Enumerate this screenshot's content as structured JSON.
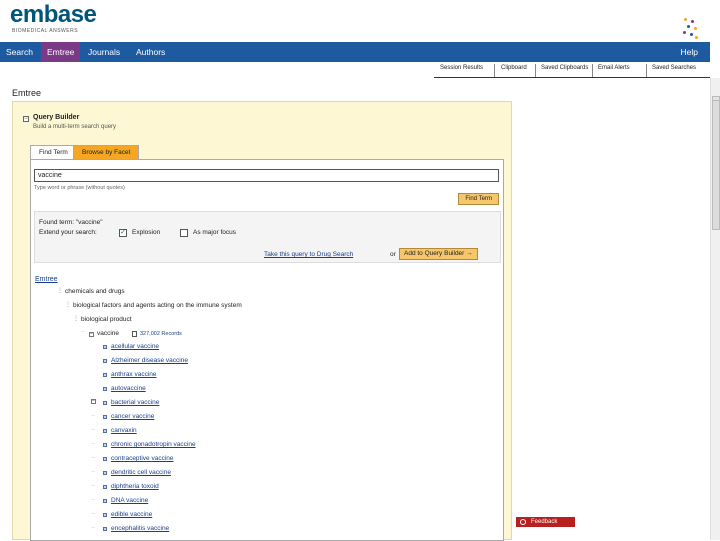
{
  "brand": {
    "name": "embase",
    "tagline": "BIOMEDICAL ANSWERS"
  },
  "nav": {
    "items": [
      "Search",
      "Emtree",
      "Journals",
      "Authors"
    ],
    "active": "Emtree",
    "help": "Help"
  },
  "subnav": [
    "Session Results",
    "Clipboard",
    "Saved Clipboards",
    "Email Alerts",
    "Saved Searches"
  ],
  "page_title": "Emtree",
  "query_builder": {
    "title": "Query Builder",
    "subtitle": "Build a multi-term search query",
    "tabs": [
      "Find Term",
      "Browse by Facet"
    ],
    "search_value": "vaccine",
    "search_hint": "Type word or phrase (without quotes)",
    "find_button": "Find Term",
    "found_label": "Found term: \"vaccine\"",
    "refine_label": "Extend your search:",
    "explosion_label": "Explosion",
    "major_focus_label": "As major focus",
    "drug_search_link": "Take this query to Drug Search",
    "or_text": "or",
    "add_button": "Add to Query Builder →"
  },
  "tree": {
    "root": "Emtree",
    "level1": "chemicals and drugs",
    "level2": "biological factors and agents acting on the immune system",
    "level3": "biological product",
    "current": "vaccine",
    "records": "327,002 Records",
    "children": [
      "acellular vaccine",
      "Alzheimer disease vaccine",
      "anthrax vaccine",
      "autovaccine",
      "bacterial vaccine",
      "cancer vaccine",
      "canvaxin",
      "chronic gonadotropin vaccine",
      "contraceptive vaccine",
      "dendritic cell vaccine",
      "diphtheria toxoid",
      "DNA vaccine",
      "edible vaccine",
      "encephalitis vaccine"
    ],
    "expanded_child": "bacterial vaccine"
  },
  "feedback": "Feedback",
  "colors": {
    "nav_bg": "#1d5aa0",
    "nav_active": "#7a3a86",
    "panel_bg": "#fdf7d4",
    "button": "#f5c66a",
    "tab_inactive": "#f5a623",
    "link": "#1a3f8a",
    "feedback": "#b81f1f"
  }
}
